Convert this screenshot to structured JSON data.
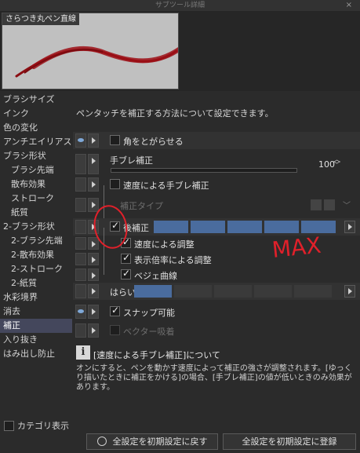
{
  "window": {
    "title": "サブツール詳細",
    "close_glyph": "×"
  },
  "preview": {
    "brush_name": "さらつき丸ペン直線"
  },
  "sidebar": {
    "items": [
      "ブラシサイズ",
      "インク",
      "色の変化",
      "アンチエイリアス",
      "ブラシ形状",
      "ブラシ先端",
      "散布効果",
      "ストローク",
      "紙質",
      "2-ブラシ形状",
      "2-ブラシ先端",
      "2-散布効果",
      "2-ストローク",
      "2-紙質",
      "水彩境界",
      "消去",
      "補正",
      "入り抜き",
      "はみ出し防止"
    ],
    "selected": "補正",
    "category_label": "カテゴリ表示"
  },
  "main": {
    "description": "ペンタッチを補正する方法について設定できます。",
    "rows": {
      "kado": "角をとがらせる",
      "tebure": "手ブレ補正",
      "tebure_value": "100",
      "sokudo": "速度による手ブレ補正",
      "hosei_type": "補正タイプ",
      "atohosei": "後補正",
      "sokudo_chosei": "速度による調整",
      "bairitsu": "表示倍率による調整",
      "bezier": "ベジェ曲線",
      "harai": "はらい",
      "snap": "スナップ可能",
      "vector": "ベクター吸着"
    }
  },
  "info": {
    "icon": "i",
    "title": "[速度による手ブレ補正]について",
    "body": "オンにすると、ペンを動かす速度によって補正の強さが調整されます。[ゆっくり描いたときに補正をかける]の場合、[手ブレ補正]の値が低いときのみ効果があります。"
  },
  "annotation": {
    "text": "MAX",
    "color": "#e0202a"
  },
  "footer": {
    "reset_label": "全設定を初期設定に戻す",
    "register_label": "全設定を初期設定に登録"
  },
  "colors": {
    "accent": "#4a6c9e",
    "selected_bg": "#44475c",
    "stroke": "#8b0d12"
  }
}
